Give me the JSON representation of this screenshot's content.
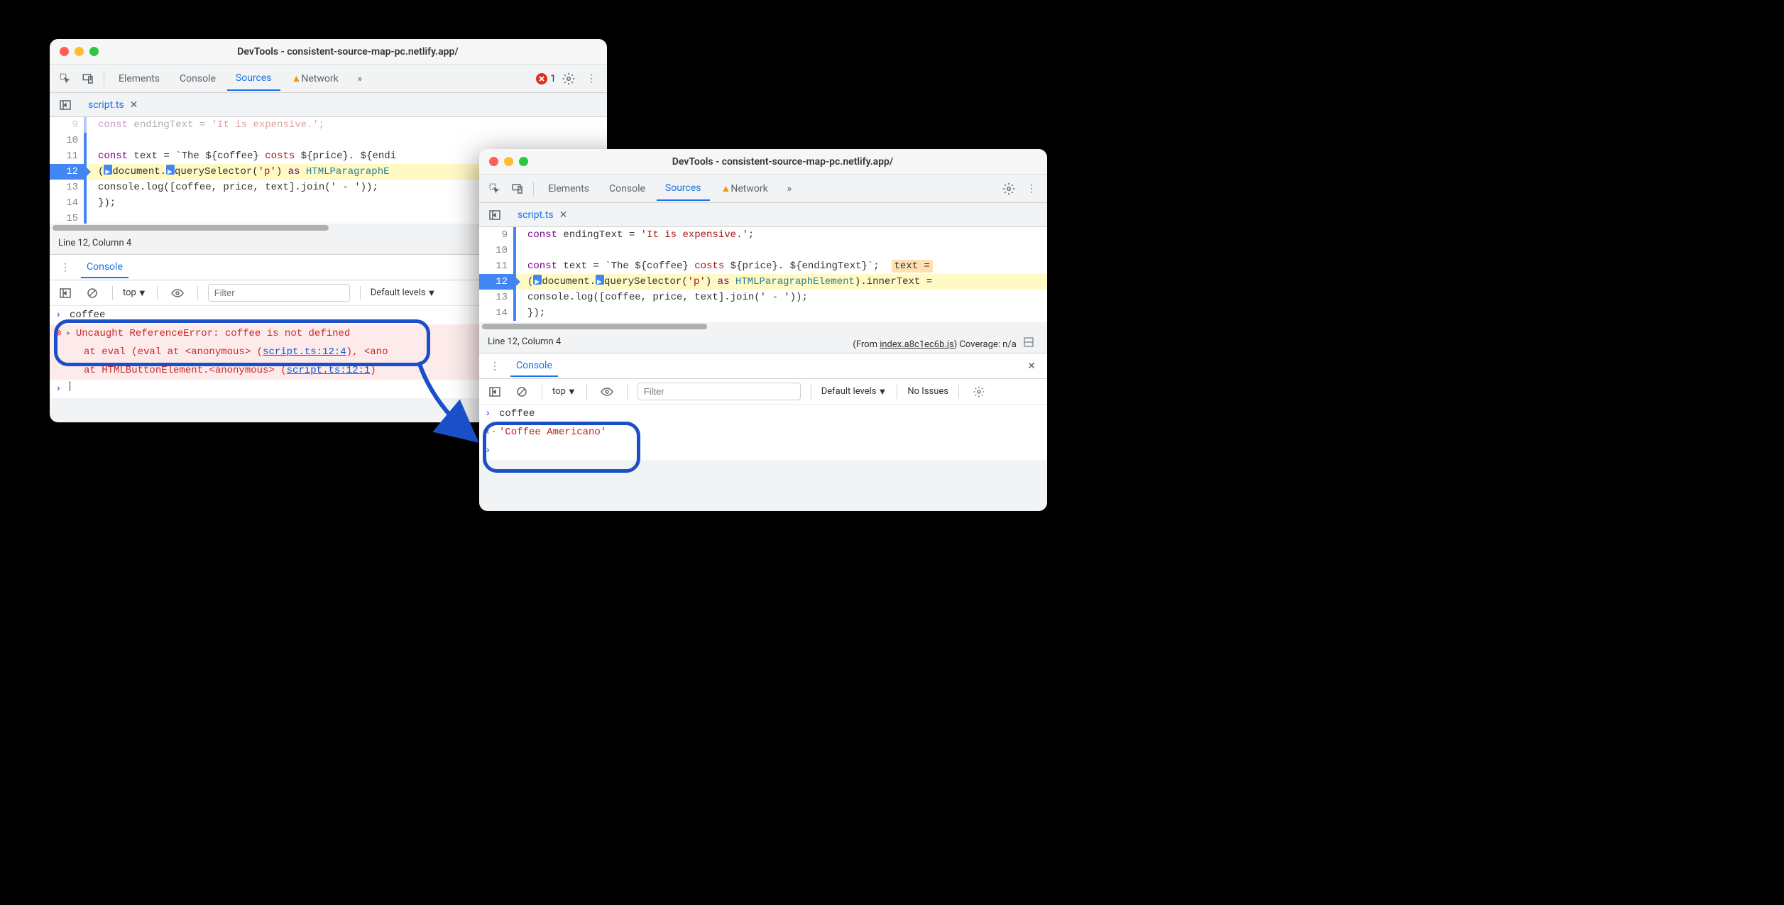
{
  "window1": {
    "title": "DevTools - consistent-source-map-pc.netlify.app/",
    "tabs": {
      "elements": "Elements",
      "console": "Console",
      "sources": "Sources",
      "network": "Network"
    },
    "error_count": "1",
    "file": {
      "name": "script.ts"
    },
    "lines": {
      "l9": "9",
      "l9_text": "const endingText = 'It is expensive.';",
      "l10": "10",
      "l11": "11",
      "l11_kw": "const",
      "l11_text": " text = `The ${coffee} ",
      "l11_costs": "costs",
      "l11_rest": " ${price}. ${endi",
      "l12": "12",
      "l12_doc": "document",
      "l12_qs": "querySelector",
      "l12_arg": "'p'",
      "l12_as": " as ",
      "l12_cls": "HTMLParagraphE",
      "l13": "13",
      "l13_text": "console.log([coffee, price, text].join(' - '));",
      "l14": "14",
      "l14_text": "});",
      "l15": "15"
    },
    "status": {
      "pos": "Line 12, Column 4",
      "from": "(From ",
      "link": "index.a8c1ec6b.js"
    },
    "console": {
      "title": "Console",
      "filter_placeholder": "Filter",
      "levels": "Default levels",
      "input": "coffee",
      "err": "Uncaught ReferenceError: coffee is not defined",
      "trace1_a": "at eval (eval at <anonymous> (",
      "trace1_link": "script.ts:12:4",
      "trace1_b": "), <ano",
      "trace2_a": "at HTMLButtonElement.<anonymous> (",
      "trace2_link": "script.ts:12:1",
      "trace2_b": ")",
      "top": "top"
    }
  },
  "window2": {
    "title": "DevTools - consistent-source-map-pc.netlify.app/",
    "tabs": {
      "elements": "Elements",
      "console": "Console",
      "sources": "Sources",
      "network": "Network"
    },
    "file": {
      "name": "script.ts"
    },
    "lines": {
      "l9": "9",
      "l9_a": "const",
      "l9_b": " endingText = ",
      "l9_c": "'It is expensive.'",
      "l9_d": ";",
      "l10": "10",
      "l11": "11",
      "l11_a": "const",
      "l11_b": " text = `The ${coffee} ",
      "l11_c": "costs",
      "l11_d": " ${price}. ${endingText}`;  ",
      "l11_var": "text =",
      "l12": "12",
      "l12_doc": "document",
      "l12_qs": "querySelector",
      "l12_arg": "'p'",
      "l12_as": " as ",
      "l12_cls": "HTMLParagraphElement",
      "l12_rest": ").innerText =",
      "l13": "13",
      "l13_text": "console.log([coffee, price, text].join(' - '));",
      "l14": "14",
      "l14_text": "});"
    },
    "status": {
      "pos": "Line 12, Column 4",
      "from": "(From ",
      "link": "index.a8c1ec6b.js",
      "cov": "Coverage: n/a"
    },
    "console": {
      "title": "Console",
      "filter_placeholder": "Filter",
      "levels": "Default levels",
      "issues": "No Issues",
      "input": "coffee",
      "output": "'Coffee Americano'",
      "top": "top"
    }
  }
}
